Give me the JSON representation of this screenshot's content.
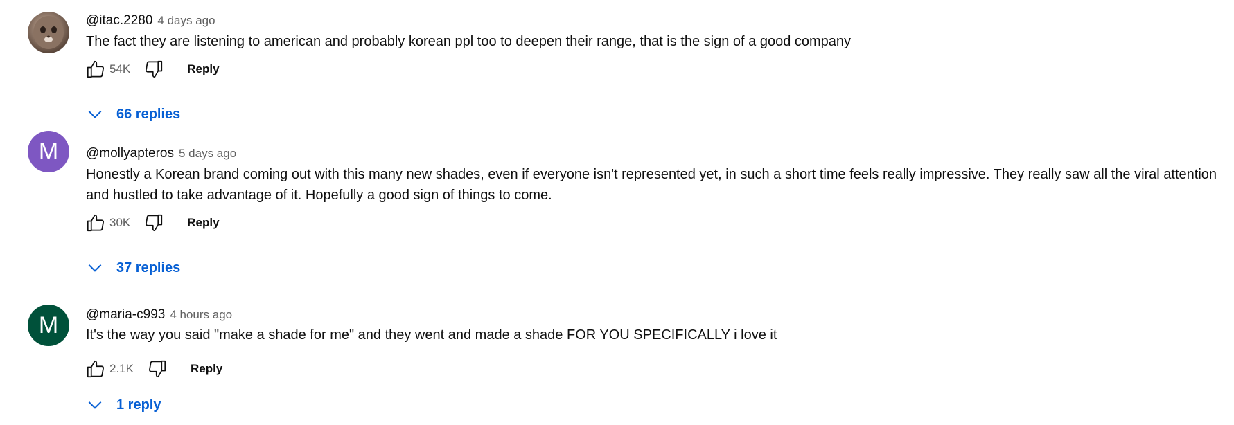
{
  "comments": [
    {
      "avatar_type": "photo",
      "author": "@itac.2280",
      "time": "4 days ago",
      "text": "The fact they are listening to american and probably korean ppl too to deepen their range, that is the sign of a good company",
      "likes": "54K",
      "reply_label": "Reply",
      "replies_label": "66 replies"
    },
    {
      "avatar_type": "letter",
      "avatar_letter": "M",
      "avatar_color": "#7e57c2",
      "author": "@mollyapteros",
      "time": "5 days ago",
      "text": "Honestly a Korean brand coming out with this many new shades, even if everyone isn't represented yet, in such a short time feels really impressive. They really saw all the viral attention and hustled to take advantage of it. Hopefully a good sign of things to come.",
      "likes": "30K",
      "reply_label": "Reply",
      "replies_label": "37 replies"
    },
    {
      "avatar_type": "letter",
      "avatar_letter": "M",
      "avatar_color": "#00513a",
      "author": "@maria-c993",
      "time": "4 hours ago",
      "text": "It's the way you said \"make a shade for me\" and they went and made a shade FOR YOU SPECIFICALLY i love it",
      "likes": "2.1K",
      "reply_label": "Reply",
      "replies_label": "1 reply"
    }
  ],
  "icons": {
    "like": "thumbs-up-icon",
    "dislike": "thumbs-down-icon",
    "expand": "chevron-down-icon"
  },
  "colors": {
    "link": "#065fd4",
    "meta": "#606060",
    "text": "#0f0f0f"
  }
}
